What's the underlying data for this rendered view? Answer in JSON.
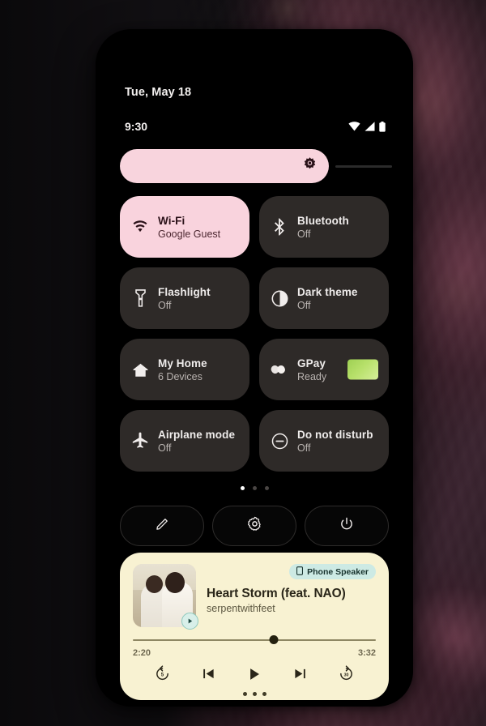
{
  "statusbar": {
    "date": "Tue, May 18",
    "clock": "9:30",
    "icons": [
      "wifi-icon",
      "cellular-signal-icon",
      "battery-icon"
    ]
  },
  "brightness": {
    "name": "brightness-slider",
    "icon": "brightness-icon",
    "value_percent": 68
  },
  "tiles": [
    {
      "title": "Wi-Fi",
      "subtitle": "Google Guest",
      "icon": "wifi-icon",
      "active": true,
      "name": "tile-wifi"
    },
    {
      "title": "Bluetooth",
      "subtitle": "Off",
      "icon": "bluetooth-icon",
      "active": false,
      "name": "tile-bluetooth"
    },
    {
      "title": "Flashlight",
      "subtitle": "Off",
      "icon": "flashlight-icon",
      "active": false,
      "name": "tile-flashlight"
    },
    {
      "title": "Dark theme",
      "subtitle": "Off",
      "icon": "dark-theme-icon",
      "active": false,
      "name": "tile-dark-theme"
    },
    {
      "title": "My Home",
      "subtitle": "6 Devices",
      "icon": "home-icon",
      "active": false,
      "name": "tile-my-home"
    },
    {
      "title": "GPay",
      "subtitle": "Ready",
      "icon": "gpay-icon",
      "active": false,
      "name": "tile-gpay",
      "thumbnail": "payment-card-thumbnail"
    },
    {
      "title": "Airplane mode",
      "subtitle": "Off",
      "icon": "airplane-icon",
      "active": false,
      "name": "tile-airplane-mode"
    },
    {
      "title": "Do not disturb",
      "subtitle": "Off",
      "icon": "do-not-disturb-icon",
      "active": false,
      "name": "tile-do-not-disturb"
    }
  ],
  "page_dots": {
    "total": 3,
    "active_index": 0
  },
  "footer_buttons": [
    {
      "icon": "pencil-edit-icon",
      "name": "edit-tiles-button"
    },
    {
      "icon": "gear-settings-icon",
      "name": "settings-button"
    },
    {
      "icon": "power-icon",
      "name": "power-button"
    }
  ],
  "media": {
    "title": "Heart Storm (feat. NAO)",
    "artist": "serpentwithfeet",
    "output_device": "Phone Speaker",
    "output_icon": "phone-speaker-icon",
    "album_art": "album-art-two-people-embracing",
    "play_badge_icon": "play-circle-icon",
    "elapsed": "2:20",
    "duration": "3:32",
    "progress_percent": 58,
    "controls": [
      {
        "icon": "replay-5-icon",
        "name": "rewind-5-button"
      },
      {
        "icon": "previous-icon",
        "name": "previous-track-button"
      },
      {
        "icon": "play-icon",
        "name": "play-button"
      },
      {
        "icon": "next-icon",
        "name": "next-track-button"
      },
      {
        "icon": "forward-30-icon",
        "name": "forward-30-button"
      }
    ],
    "carousel_dots": 3
  },
  "colors": {
    "accent_pink": "#f9d3dd",
    "tile_inactive": "#2e2a28",
    "media_card": "#f8f2d2",
    "chip_teal": "#cdeae4",
    "gpay_card_green": "#b7e06a",
    "screen_black": "#000000"
  }
}
